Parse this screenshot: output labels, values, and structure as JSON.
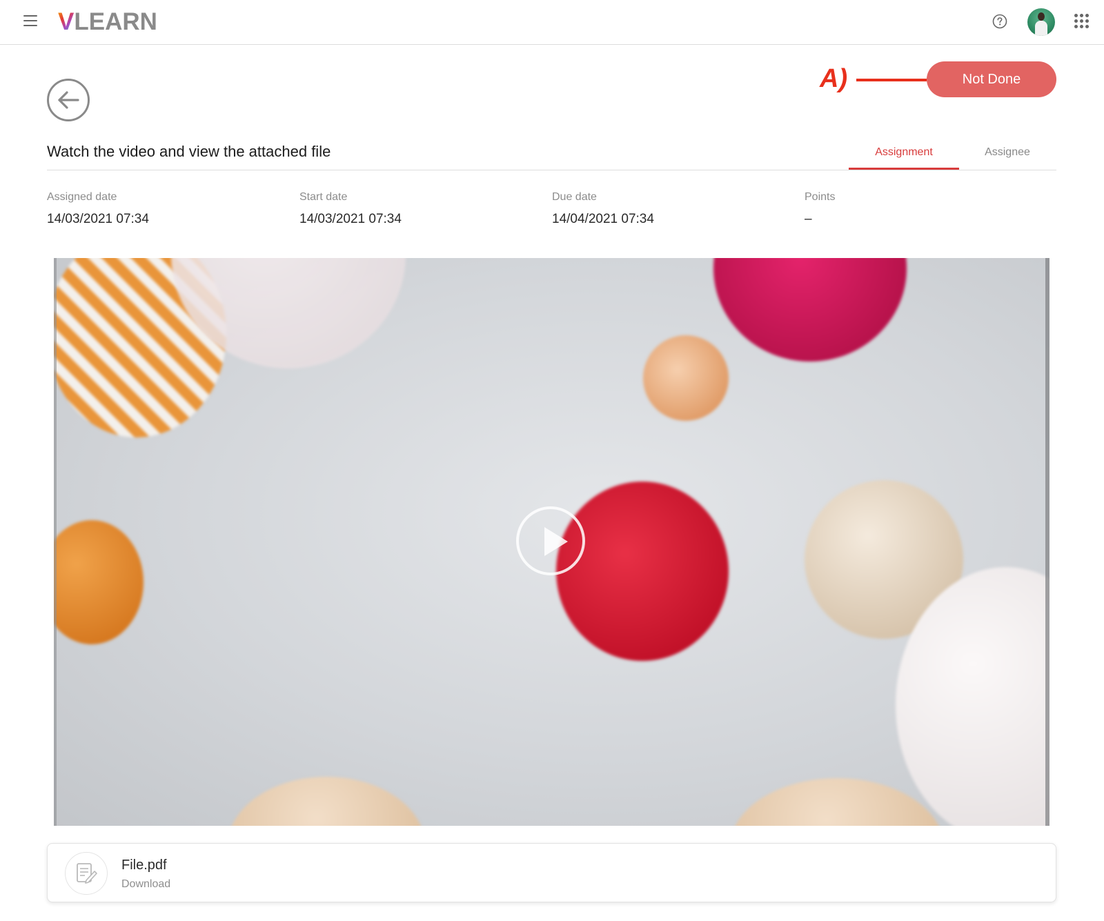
{
  "app": {
    "logo_mark": "V",
    "logo_text": "LEARN"
  },
  "header": {
    "icons": [
      "menu-icon",
      "help-icon",
      "avatar",
      "apps-grid-icon"
    ]
  },
  "annotation": {
    "label": "A)",
    "color": "#e8301c"
  },
  "status_button": {
    "label": "Not Done",
    "color": "#e26462"
  },
  "assignment": {
    "title": "Watch the video and view the attached file"
  },
  "tabs": [
    {
      "label": "Assignment",
      "active": true
    },
    {
      "label": "Assignee",
      "active": false
    }
  ],
  "meta": [
    {
      "label": "Assigned date",
      "value": "14/03/2021 07:34"
    },
    {
      "label": "Start date",
      "value": "14/03/2021 07:34"
    },
    {
      "label": "Due date",
      "value": "14/04/2021 07:34"
    },
    {
      "label": "Points",
      "value": "–"
    }
  ],
  "video": {
    "play_icon": "play-icon"
  },
  "attachment": {
    "name": "File.pdf",
    "action": "Download",
    "icon": "document-edit-icon"
  },
  "colors": {
    "accent": "#d83c3c"
  }
}
